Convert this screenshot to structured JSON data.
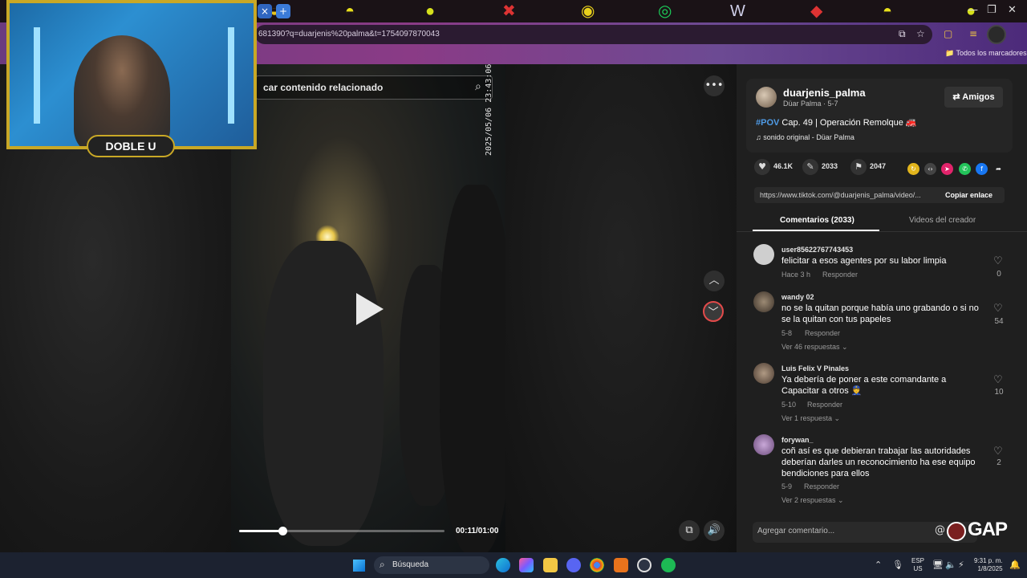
{
  "browser": {
    "url": "681390?q=duarjenis%20palma&t=1754097870043",
    "bookmarks_label": "Todos los marcadores",
    "tab_close": "×",
    "tab_new": "+"
  },
  "video": {
    "search_placeholder": "car contenido relacionado",
    "timestamp_overlay": "2025/05/06 23:43:06",
    "time": "00:11/01:00",
    "progress": 0.21
  },
  "creator": {
    "username": "duarjenis_palma",
    "subtitle": "Düar Palma · 5-7",
    "follow_label": "Amigos",
    "caption_tag": "#POV",
    "caption_text": " Cap. 49 | Operación Remolque 🚒",
    "sound": "sonido original - Düar Palma"
  },
  "stats": {
    "likes": "46.1K",
    "comments": "2033",
    "saves": "2047"
  },
  "link": {
    "url": "https://www.tiktok.com/@duarjenis_palma/video/...",
    "copy_label": "Copiar enlace"
  },
  "tabs": {
    "comments": "Comentarios (2033)",
    "creator_videos": "Videos del creador"
  },
  "comments": [
    {
      "user": "user85622767743453",
      "text": "felicitar a esos agentes por su labor limpia",
      "meta": "Hace 3 h",
      "reply": "Responder",
      "likes": "0",
      "more": ""
    },
    {
      "user": "wandy 02",
      "text": "no se la quitan porque había uno grabando o si no se la quitan con tus papeles",
      "meta": "5-8",
      "reply": "Responder",
      "likes": "54",
      "more": "Ver 46 respuestas ⌄"
    },
    {
      "user": "Luis Felix V Pinales",
      "text": "Ya debería de poner a este comandante a Capacitar a otros 👮",
      "meta": "5-10",
      "reply": "Responder",
      "likes": "10",
      "more": "Ver 1 respuesta ⌄"
    },
    {
      "user": "forywan_",
      "text": "coñ así es que debieran trabajar las autoridades deberían darles un reconocimiento ha ese equipo bendiciones para ellos",
      "meta": "5-9",
      "reply": "Responder",
      "likes": "2",
      "more": "Ver 2 respuestas ⌄"
    }
  ],
  "add_comment_placeholder": "Agregar comentario...",
  "watermark": "GAP",
  "stream_badge": "DOBLE U",
  "taskbar": {
    "search_label": "Búsqueda",
    "lang_top": "ESP",
    "lang_bottom": "US",
    "time": "9:31 p. m.",
    "date": "1/8/2025"
  },
  "colors": {
    "accent_tag": "#4f9be6",
    "highlight_ring": "#e34a4a"
  }
}
